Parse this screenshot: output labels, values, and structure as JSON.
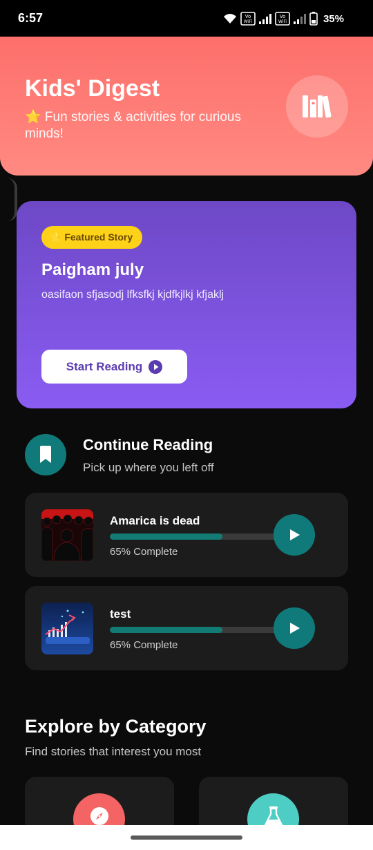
{
  "status_bar": {
    "time": "6:57",
    "battery_percent": "35%",
    "icons": [
      "wifi-icon",
      "volte-wifi-icon",
      "signal-icon",
      "volte-wifi-icon",
      "signal-icon",
      "battery-icon"
    ],
    "volte_label": "Vo WiFi"
  },
  "header": {
    "title": "Kids' Digest",
    "subtitle": "⭐ Fun stories & activities for curious minds!",
    "icon": "library-icon",
    "color": "#fe6f6b"
  },
  "featured": {
    "badge": "⭐ Featured Story",
    "title": "Paigham july",
    "description": "oasifaon sfjasodj lfksfkj kjdfkjlkj kfjaklj",
    "button_label": "Start Reading",
    "button_icon": "play-circle-icon",
    "color": "#7b52e0"
  },
  "continue_reading": {
    "icon": "bookmark-icon",
    "title": "Continue Reading",
    "subtitle": "Pick up where you left off",
    "items": [
      {
        "title": "Amarica is dead",
        "progress": 0.65,
        "progress_text": "65% Complete",
        "thumbnail": "crowd-silhouette-image"
      },
      {
        "title": "test",
        "progress": 0.65,
        "progress_text": "65% Complete",
        "thumbnail": "growth-chart-image"
      }
    ]
  },
  "explore": {
    "title": "Explore by Category",
    "subtitle": "Find stories that interest you most",
    "categories": [
      {
        "icon": "compass-icon",
        "color": "#f46464"
      },
      {
        "icon": "flask-icon",
        "color": "#4ecdc4"
      }
    ]
  },
  "accent_color": "#107a7a"
}
